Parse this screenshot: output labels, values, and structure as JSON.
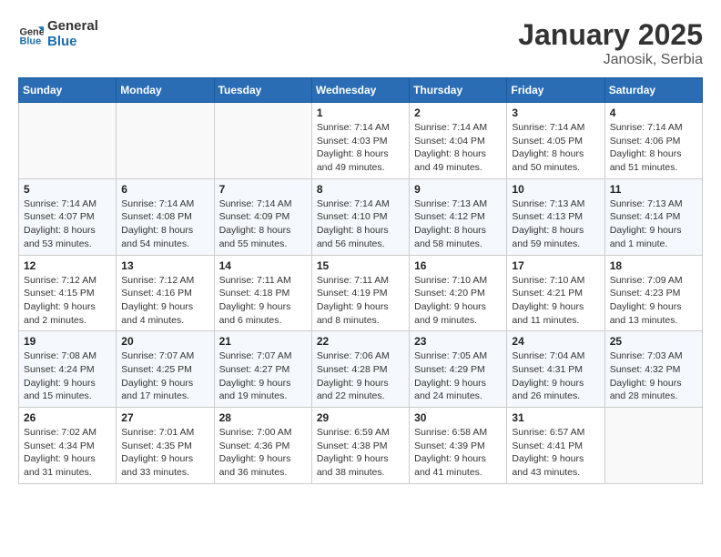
{
  "header": {
    "logo_general": "General",
    "logo_blue": "Blue",
    "month_year": "January 2025",
    "location": "Janosik, Serbia"
  },
  "weekdays": [
    "Sunday",
    "Monday",
    "Tuesday",
    "Wednesday",
    "Thursday",
    "Friday",
    "Saturday"
  ],
  "weeks": [
    [
      {
        "day": "",
        "sunrise": "",
        "sunset": "",
        "daylight": ""
      },
      {
        "day": "",
        "sunrise": "",
        "sunset": "",
        "daylight": ""
      },
      {
        "day": "",
        "sunrise": "",
        "sunset": "",
        "daylight": ""
      },
      {
        "day": "1",
        "sunrise": "Sunrise: 7:14 AM",
        "sunset": "Sunset: 4:03 PM",
        "daylight": "Daylight: 8 hours and 49 minutes."
      },
      {
        "day": "2",
        "sunrise": "Sunrise: 7:14 AM",
        "sunset": "Sunset: 4:04 PM",
        "daylight": "Daylight: 8 hours and 49 minutes."
      },
      {
        "day": "3",
        "sunrise": "Sunrise: 7:14 AM",
        "sunset": "Sunset: 4:05 PM",
        "daylight": "Daylight: 8 hours and 50 minutes."
      },
      {
        "day": "4",
        "sunrise": "Sunrise: 7:14 AM",
        "sunset": "Sunset: 4:06 PM",
        "daylight": "Daylight: 8 hours and 51 minutes."
      }
    ],
    [
      {
        "day": "5",
        "sunrise": "Sunrise: 7:14 AM",
        "sunset": "Sunset: 4:07 PM",
        "daylight": "Daylight: 8 hours and 53 minutes."
      },
      {
        "day": "6",
        "sunrise": "Sunrise: 7:14 AM",
        "sunset": "Sunset: 4:08 PM",
        "daylight": "Daylight: 8 hours and 54 minutes."
      },
      {
        "day": "7",
        "sunrise": "Sunrise: 7:14 AM",
        "sunset": "Sunset: 4:09 PM",
        "daylight": "Daylight: 8 hours and 55 minutes."
      },
      {
        "day": "8",
        "sunrise": "Sunrise: 7:14 AM",
        "sunset": "Sunset: 4:10 PM",
        "daylight": "Daylight: 8 hours and 56 minutes."
      },
      {
        "day": "9",
        "sunrise": "Sunrise: 7:13 AM",
        "sunset": "Sunset: 4:12 PM",
        "daylight": "Daylight: 8 hours and 58 minutes."
      },
      {
        "day": "10",
        "sunrise": "Sunrise: 7:13 AM",
        "sunset": "Sunset: 4:13 PM",
        "daylight": "Daylight: 8 hours and 59 minutes."
      },
      {
        "day": "11",
        "sunrise": "Sunrise: 7:13 AM",
        "sunset": "Sunset: 4:14 PM",
        "daylight": "Daylight: 9 hours and 1 minute."
      }
    ],
    [
      {
        "day": "12",
        "sunrise": "Sunrise: 7:12 AM",
        "sunset": "Sunset: 4:15 PM",
        "daylight": "Daylight: 9 hours and 2 minutes."
      },
      {
        "day": "13",
        "sunrise": "Sunrise: 7:12 AM",
        "sunset": "Sunset: 4:16 PM",
        "daylight": "Daylight: 9 hours and 4 minutes."
      },
      {
        "day": "14",
        "sunrise": "Sunrise: 7:11 AM",
        "sunset": "Sunset: 4:18 PM",
        "daylight": "Daylight: 9 hours and 6 minutes."
      },
      {
        "day": "15",
        "sunrise": "Sunrise: 7:11 AM",
        "sunset": "Sunset: 4:19 PM",
        "daylight": "Daylight: 9 hours and 8 minutes."
      },
      {
        "day": "16",
        "sunrise": "Sunrise: 7:10 AM",
        "sunset": "Sunset: 4:20 PM",
        "daylight": "Daylight: 9 hours and 9 minutes."
      },
      {
        "day": "17",
        "sunrise": "Sunrise: 7:10 AM",
        "sunset": "Sunset: 4:21 PM",
        "daylight": "Daylight: 9 hours and 11 minutes."
      },
      {
        "day": "18",
        "sunrise": "Sunrise: 7:09 AM",
        "sunset": "Sunset: 4:23 PM",
        "daylight": "Daylight: 9 hours and 13 minutes."
      }
    ],
    [
      {
        "day": "19",
        "sunrise": "Sunrise: 7:08 AM",
        "sunset": "Sunset: 4:24 PM",
        "daylight": "Daylight: 9 hours and 15 minutes."
      },
      {
        "day": "20",
        "sunrise": "Sunrise: 7:07 AM",
        "sunset": "Sunset: 4:25 PM",
        "daylight": "Daylight: 9 hours and 17 minutes."
      },
      {
        "day": "21",
        "sunrise": "Sunrise: 7:07 AM",
        "sunset": "Sunset: 4:27 PM",
        "daylight": "Daylight: 9 hours and 19 minutes."
      },
      {
        "day": "22",
        "sunrise": "Sunrise: 7:06 AM",
        "sunset": "Sunset: 4:28 PM",
        "daylight": "Daylight: 9 hours and 22 minutes."
      },
      {
        "day": "23",
        "sunrise": "Sunrise: 7:05 AM",
        "sunset": "Sunset: 4:29 PM",
        "daylight": "Daylight: 9 hours and 24 minutes."
      },
      {
        "day": "24",
        "sunrise": "Sunrise: 7:04 AM",
        "sunset": "Sunset: 4:31 PM",
        "daylight": "Daylight: 9 hours and 26 minutes."
      },
      {
        "day": "25",
        "sunrise": "Sunrise: 7:03 AM",
        "sunset": "Sunset: 4:32 PM",
        "daylight": "Daylight: 9 hours and 28 minutes."
      }
    ],
    [
      {
        "day": "26",
        "sunrise": "Sunrise: 7:02 AM",
        "sunset": "Sunset: 4:34 PM",
        "daylight": "Daylight: 9 hours and 31 minutes."
      },
      {
        "day": "27",
        "sunrise": "Sunrise: 7:01 AM",
        "sunset": "Sunset: 4:35 PM",
        "daylight": "Daylight: 9 hours and 33 minutes."
      },
      {
        "day": "28",
        "sunrise": "Sunrise: 7:00 AM",
        "sunset": "Sunset: 4:36 PM",
        "daylight": "Daylight: 9 hours and 36 minutes."
      },
      {
        "day": "29",
        "sunrise": "Sunrise: 6:59 AM",
        "sunset": "Sunset: 4:38 PM",
        "daylight": "Daylight: 9 hours and 38 minutes."
      },
      {
        "day": "30",
        "sunrise": "Sunrise: 6:58 AM",
        "sunset": "Sunset: 4:39 PM",
        "daylight": "Daylight: 9 hours and 41 minutes."
      },
      {
        "day": "31",
        "sunrise": "Sunrise: 6:57 AM",
        "sunset": "Sunset: 4:41 PM",
        "daylight": "Daylight: 9 hours and 43 minutes."
      },
      {
        "day": "",
        "sunrise": "",
        "sunset": "",
        "daylight": ""
      }
    ]
  ]
}
